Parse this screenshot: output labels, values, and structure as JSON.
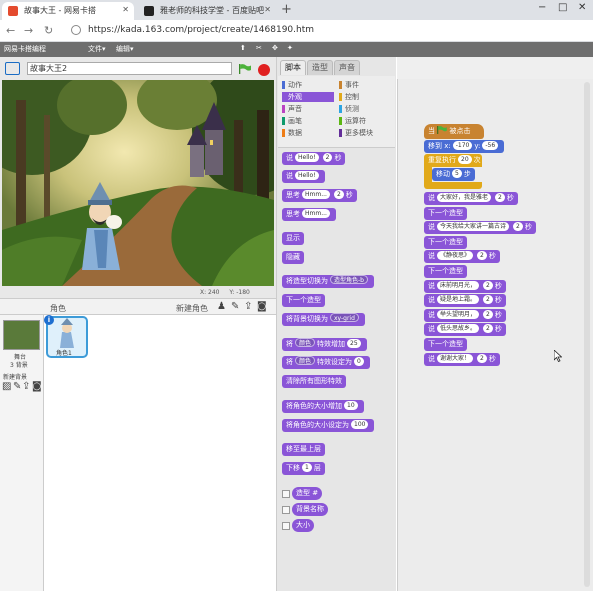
{
  "browser": {
    "tabs": [
      {
        "title": "故事大王 - 网易卡搭",
        "active": true,
        "color": "#e44b2e"
      },
      {
        "title": "雅老师的科技学堂 - 百度贴吧",
        "active": false,
        "color": "#222222"
      }
    ],
    "url": "https://kada.163.com/project/create/1468190.htm",
    "new_tab": "+",
    "window_buttons": [
      "−",
      "□",
      "✕"
    ]
  },
  "menubar": {
    "logo": "网易卡搭编程",
    "file": "文件▾",
    "edit": "编辑▾"
  },
  "stage": {
    "project_name": "故事大王2",
    "coords": {
      "x_label": "X: 240",
      "y_label": "Y: -180"
    }
  },
  "sprites_panel": {
    "header": "角色",
    "new_sprite": "新建角色",
    "stage_thumb_label": "舞台",
    "stage_thumb_sub": "3 背景",
    "new_backdrop": "新建背景",
    "sprite_name": "角色1"
  },
  "tabs": {
    "scripts": "脚本",
    "costumes": "造型",
    "sounds": "声音"
  },
  "categories": [
    {
      "label": "动作",
      "color": "#4a6cd4",
      "selected": false
    },
    {
      "label": "事件",
      "color": "#c88330",
      "selected": false
    },
    {
      "label": "外观",
      "color": "#8a55d7",
      "selected": true
    },
    {
      "label": "控制",
      "color": "#e1a91a",
      "selected": false
    },
    {
      "label": "声音",
      "color": "#bb42c3",
      "selected": false
    },
    {
      "label": "侦测",
      "color": "#2ca5e2",
      "selected": false
    },
    {
      "label": "画笔",
      "color": "#0e9a6c",
      "selected": false
    },
    {
      "label": "运算符",
      "color": "#5cb712",
      "selected": false
    },
    {
      "label": "数据",
      "color": "#ee7d16",
      "selected": false
    },
    {
      "label": "更多模块",
      "color": "#632d99",
      "selected": false
    }
  ],
  "palette": {
    "say_secs": {
      "pre": "说",
      "msg": "Hello!",
      "secs": "2",
      "post": "秒"
    },
    "say": {
      "pre": "说",
      "msg": "Hello!"
    },
    "think_secs": {
      "pre": "思考",
      "msg": "Hmm...",
      "secs": "2",
      "post": "秒"
    },
    "think": {
      "pre": "思考",
      "msg": "Hmm..."
    },
    "show": "显示",
    "hide": "隐藏",
    "switch_costume": {
      "pre": "将造型切换为",
      "val": "造型角色-b"
    },
    "next_costume": "下一个造型",
    "switch_backdrop": {
      "pre": "将背景切换为",
      "val": "xy-grid"
    },
    "change_effect": {
      "pre": "将",
      "effect": "颜色",
      "mid": "特效增加",
      "val": "25"
    },
    "set_effect": {
      "pre": "将",
      "effect": "颜色",
      "mid": "特效设定为",
      "val": "0"
    },
    "clear_effects": "清除所有图形特效",
    "change_size": {
      "pre": "将角色的大小增加",
      "val": "10"
    },
    "set_size": {
      "pre": "将角色的大小设定为",
      "val": "100"
    },
    "go_front": "移至最上层",
    "go_back": {
      "pre": "下移",
      "val": "1",
      "post": "层"
    },
    "costume_num": "造型 #",
    "backdrop_name": "背景名称",
    "size": "大小"
  },
  "script": {
    "hat": {
      "pre": "当",
      "post": "被点击"
    },
    "goto": {
      "pre": "移到 x:",
      "x": "-170",
      "mid": "y:",
      "y": "-56"
    },
    "repeat": {
      "pre": "重复执行",
      "val": "20",
      "post": "次"
    },
    "move": {
      "pre": "移动",
      "val": "5",
      "post": "步"
    },
    "lines": [
      {
        "type": "say",
        "msg": "大家好，我是雅老",
        "secs": "2"
      },
      {
        "type": "next",
        "label": "下一个造型"
      },
      {
        "type": "say",
        "msg": "今天我给大家讲一篇古诗",
        "secs": "2"
      },
      {
        "type": "next",
        "label": "下一个造型"
      },
      {
        "type": "say",
        "msg": "《静夜思》",
        "secs": "2"
      },
      {
        "type": "next",
        "label": "下一个造型"
      },
      {
        "type": "say",
        "msg": "床前明月光，",
        "secs": "2"
      },
      {
        "type": "say",
        "msg": "疑是地上霜。",
        "secs": "2"
      },
      {
        "type": "say",
        "msg": "举头望明月，",
        "secs": "2"
      },
      {
        "type": "say",
        "msg": "低头思故乡。",
        "secs": "2"
      },
      {
        "type": "next",
        "label": "下一个造型"
      },
      {
        "type": "say",
        "msg": "谢谢大家！",
        "secs": "2"
      }
    ],
    "say_word": "说",
    "secs_word": "秒"
  }
}
